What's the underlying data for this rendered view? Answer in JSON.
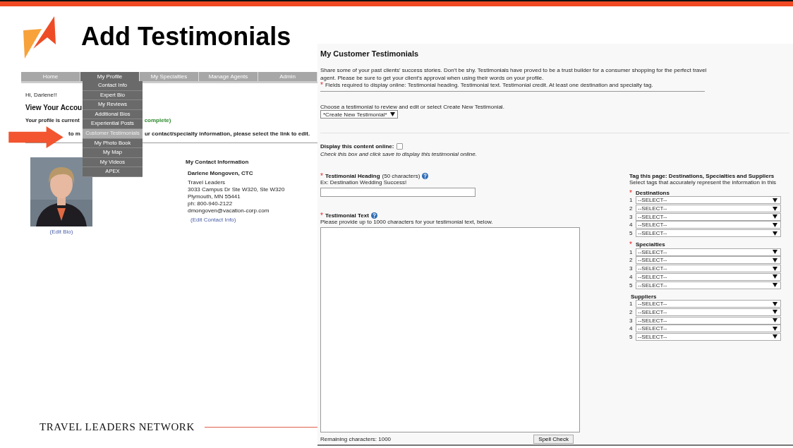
{
  "slide": {
    "title": "Add Testimonials",
    "footer_brand": "TRAVEL LEADERS NETWORK"
  },
  "account_screen": {
    "nav": [
      {
        "label": "Home",
        "selected": false
      },
      {
        "label": "My Profile",
        "selected": true
      },
      {
        "label": "My Specialties",
        "selected": false
      },
      {
        "label": "Manage Agents",
        "selected": false
      },
      {
        "label": "Admin",
        "selected": false
      }
    ],
    "menu": [
      {
        "label": "Contact Info",
        "selected": false
      },
      {
        "label": "Expert Bio",
        "selected": false
      },
      {
        "label": "My Reviews",
        "selected": false
      },
      {
        "label": "Additional Bios",
        "selected": false
      },
      {
        "label": "Experiential Posts",
        "selected": false
      },
      {
        "label": "Customer Testimonials",
        "selected": true
      },
      {
        "label": "My Photo Book",
        "selected": false
      },
      {
        "label": "My Map",
        "selected": false
      },
      {
        "label": "My Videos",
        "selected": false
      },
      {
        "label": "APEX",
        "selected": false
      }
    ],
    "greeting": "Hi, Darlene!!",
    "heading": "View Your Accou",
    "status_text": "Your profile is current",
    "status_end": "complete)",
    "instruction_start": "to m",
    "instruction_end": "ur contact/specialty information, please select the link to edit.",
    "edit_bio": "(Edit Bio)",
    "contact": {
      "title": "My Contact Information",
      "name": "Darlene Mongoven, CTC",
      "lines": [
        "Travel Leaders",
        "3033 Campus Dr Ste W320, Ste W320",
        "Plymouth, MN 55441",
        "ph: 800-940-2122",
        "dmongoven@vacation-corp.com"
      ],
      "edit_link": "(Edit Contact Info)"
    }
  },
  "testimonials_screen": {
    "title": "My Customer Testimonials",
    "description": "Share some of your past clients' success stories. Don't be shy. Testimonials have proved to be a trust builder for a consumer shopping for the perfect travel agent. Please be sure to get your client's approval when using their words on your profile.",
    "required_mark": "*",
    "required_note": "Fields required to display online: Testimonial heading. Testimonial text. Testimonial credit. At least one destination and specialty tag.",
    "choose_label": "Choose a testimonial to review and edit or select Create New Testimonial.",
    "testimonial_select": "*Create New Testimonial*",
    "display": {
      "label": "Display this content online:",
      "checked": false,
      "hint": "Check this box and click save to display this testimonial online."
    },
    "heading_field": {
      "required_mark": "*",
      "label": "Testimonial Heading",
      "limit": "(50 characters)",
      "example": "Ex: Destination Wedding Success!"
    },
    "text_field": {
      "required_mark": "*",
      "label": "Testimonial Text",
      "hint": "Please provide up to 1000 characters for your testimonial text, below.",
      "remaining": "Remaining characters: 1000",
      "spell_check": "Spell Check"
    },
    "tags": {
      "title": "Tag this page: Destinations, Specialties and Suppliers",
      "subtitle": "Select tags that accurately represent the information in this",
      "groups": [
        {
          "required_mark": "*",
          "title": "Destinations",
          "selects": [
            {
              "number": "1",
              "value": "--SELECT--"
            },
            {
              "number": "2",
              "value": "--SELECT--"
            },
            {
              "number": "3",
              "value": "--SELECT--"
            },
            {
              "number": "4",
              "value": "--SELECT--"
            },
            {
              "number": "5",
              "value": "--SELECT--"
            }
          ]
        },
        {
          "required_mark": "*",
          "title": "Specialties",
          "selects": [
            {
              "number": "1",
              "value": "--SELECT--"
            },
            {
              "number": "2",
              "value": "--SELECT--"
            },
            {
              "number": "3",
              "value": "--SELECT--"
            },
            {
              "number": "4",
              "value": "--SELECT--"
            },
            {
              "number": "5",
              "value": "--SELECT--"
            }
          ]
        },
        {
          "title": "Suppliers",
          "selects": [
            {
              "number": "1",
              "value": "--SELECT--"
            },
            {
              "number": "2",
              "value": "--SELECT--"
            },
            {
              "number": "3",
              "value": "--SELECT--"
            },
            {
              "number": "4",
              "value": "--SELECT--"
            },
            {
              "number": "5",
              "value": "--SELECT--"
            }
          ]
        }
      ]
    }
  }
}
